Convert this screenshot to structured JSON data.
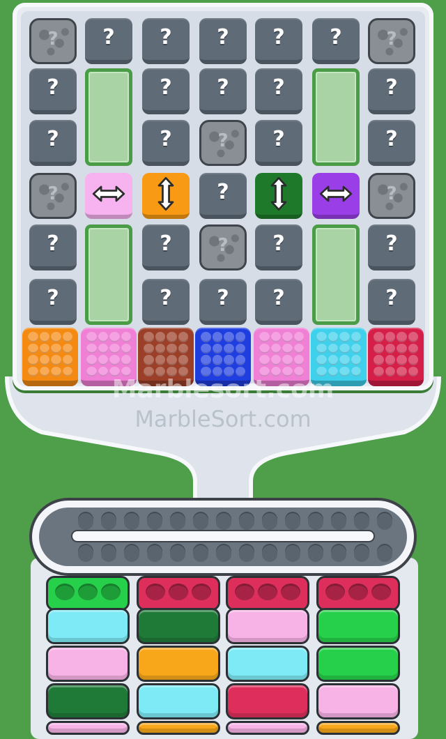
{
  "watermark_primary": "Marblesort.com",
  "watermark_secondary": "MarbleSort.com",
  "board": {
    "question_glyph": "?",
    "rows": [
      [
        "stone",
        "q",
        "q",
        "q",
        "q",
        "q",
        "stone"
      ],
      [
        "q",
        "empty-top",
        "q",
        "q",
        "q",
        "empty-top",
        "q"
      ],
      [
        "q",
        "empty-bot",
        "q",
        "stone",
        "q",
        "empty-bot",
        "q"
      ],
      [
        "stone",
        "arrow-h-pink",
        "arrow-v-orange",
        "q",
        "arrow-v-green",
        "arrow-h-purple",
        "stone"
      ],
      [
        "q",
        "empty-top",
        "q",
        "stone",
        "q",
        "empty-top",
        "q"
      ],
      [
        "q",
        "empty-bot",
        "q",
        "q",
        "q",
        "empty-bot",
        "q"
      ]
    ],
    "boxes": [
      {
        "color": "#f58a12"
      },
      {
        "color": "#f07fd6"
      },
      {
        "color": "#9b3f28"
      },
      {
        "color": "#1f3ee0"
      },
      {
        "color": "#f07fd6"
      },
      {
        "color": "#3fd0ec"
      },
      {
        "color": "#d51e48"
      }
    ]
  },
  "arrow_colors": {
    "pink": "#f7b2f0",
    "orange": "#f89a13",
    "green": "#1e7a2a",
    "purple": "#9a3ee8"
  },
  "conveyor": {
    "top_slots": 14,
    "bottom_slots": 14
  },
  "trays": [
    {
      "head": "#27d04b",
      "bars": [
        "#7eeaf5",
        "#f7b3e6",
        "#1f7a38",
        "#f7b3e6"
      ]
    },
    {
      "head": "#de2f5c",
      "bars": [
        "#1f7a38",
        "#f8a71b",
        "#7eeaf5",
        "#f8a71b"
      ]
    },
    {
      "head": "#de2f5c",
      "bars": [
        "#f7b3e6",
        "#7eeaf5",
        "#de2f5c",
        "#f7b3e6"
      ]
    },
    {
      "head": "#de2f5c",
      "bars": [
        "#27d04b",
        "#27d04b",
        "#f7b3e6",
        "#f8a71b"
      ]
    }
  ]
}
